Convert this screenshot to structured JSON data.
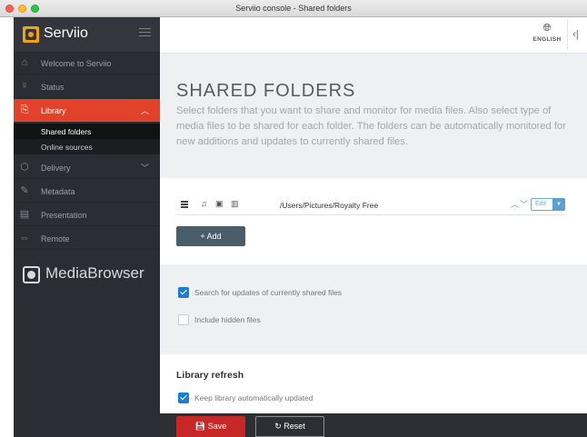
{
  "window": {
    "title": "Serviio console - Shared folders"
  },
  "brand": {
    "name": "Serviio"
  },
  "sidebar": {
    "items": [
      {
        "label": "Welcome to Serviio",
        "icon": "home-icon"
      },
      {
        "label": "Status",
        "icon": "status-icon"
      },
      {
        "label": "Library",
        "icon": "library-icon",
        "active": true,
        "chevron": "up"
      },
      {
        "label": "Delivery",
        "icon": "delivery-icon",
        "chevron": "down"
      },
      {
        "label": "Metadata",
        "icon": "metadata-icon"
      },
      {
        "label": "Presentation",
        "icon": "presentation-icon"
      },
      {
        "label": "Remote",
        "icon": "remote-icon"
      }
    ],
    "library_sub": [
      {
        "label": "Shared folders",
        "selected": true
      },
      {
        "label": "Online sources"
      }
    ]
  },
  "mediabrowser": {
    "name": "MediaBrowser"
  },
  "topbar": {
    "language": "ENGLISH"
  },
  "page": {
    "title": "SHARED FOLDERS",
    "description": "Select folders that you want to share and monitor for media files. Also select type of media files to be shared for each folder. The folders can be automatically monitored for new additions and updates to currently shared files."
  },
  "folders": [
    {
      "path": "/Users/Pictures/Royalty Free",
      "edit_label": "Edit"
    }
  ],
  "actions": {
    "add_label": "+ Add",
    "save_label": "Save",
    "reset_label": "Reset"
  },
  "options": {
    "search_updates": {
      "label": "Search for updates of currently shared files",
      "checked": true
    },
    "include_hidden": {
      "label": "Include hidden files",
      "checked": false
    }
  },
  "library_refresh": {
    "heading": "Library refresh",
    "keep_updated": {
      "label": "Keep library automatically updated",
      "checked": true
    }
  },
  "colors": {
    "accent": "#e2412a",
    "checkbox": "#1a7fd4",
    "sidebar": "#2a2d33",
    "save": "#c62828"
  }
}
